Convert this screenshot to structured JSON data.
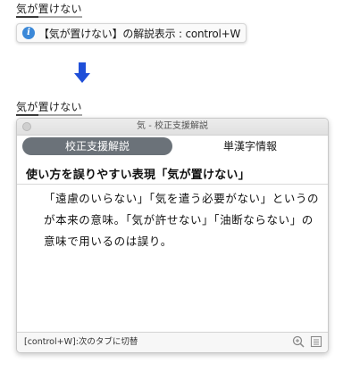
{
  "document_top": {
    "part1": "気が",
    "part2": "置けない"
  },
  "tooltip": {
    "icon": "info-icon",
    "text": "【気が置けない】の解説表示 : control+W"
  },
  "arrow": {
    "icon": "down-arrow-icon",
    "color": "#1f4fd8"
  },
  "document_bottom": {
    "part1": "気が",
    "part2": "置けない"
  },
  "panel": {
    "window_title": "気 - 校正支援解説",
    "tabs": [
      {
        "label": "校正支援解説",
        "active": true
      },
      {
        "label": "単漢字情報",
        "active": false
      }
    ],
    "heading": "使い方を誤りやすい表現「気が置けない」",
    "body": "「遠慮のいらない」「気を遣う必要がない」というのが本来の意味。「気が許せない」「油断ならない」の意味で用いるのは誤り。",
    "footer_hint": "[control+W]:次のタブに切替",
    "footer_icons": [
      "zoom-in-icon",
      "list-icon"
    ]
  },
  "colors": {
    "tab_active_bg": "#6b7279",
    "info_blue": "#3b88d8"
  }
}
